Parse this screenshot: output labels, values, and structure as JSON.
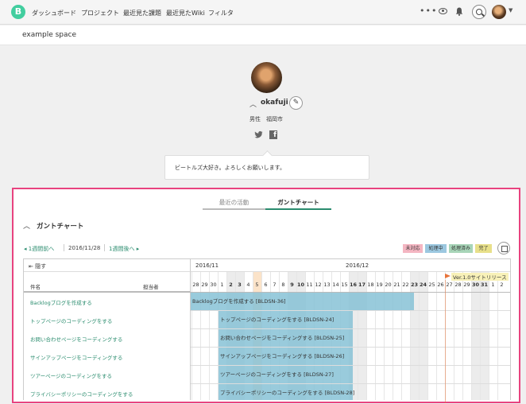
{
  "nav": {
    "logo": "B",
    "items": [
      "ダッシュボード",
      "プロジェクト",
      "最近見た課題",
      "最近見たWiki",
      "フィルタ"
    ],
    "more": "•••"
  },
  "space": {
    "name": "example space"
  },
  "profile": {
    "username": "okafuji",
    "gender": "男性",
    "city": "福岡市",
    "bio": "ビートルズ大好き。よろしくお願いします。"
  },
  "tabs": [
    {
      "label": "最近の活動",
      "active": false
    },
    {
      "label": "ガントチャート",
      "active": true
    }
  ],
  "gantt": {
    "heading": "ガントチャート",
    "prev_week": "1週間前へ",
    "current_date": "2016/11/28",
    "next_week": "1週間後へ",
    "hide": "隠す",
    "col_name": "件名",
    "col_assignee": "担当者",
    "legend": [
      {
        "label": "未対応",
        "color": "#f4b6c2"
      },
      {
        "label": "処理中",
        "color": "#9cc8e0"
      },
      {
        "label": "処理済み",
        "color": "#a8d5b8"
      },
      {
        "label": "完了",
        "color": "#e8e08a"
      }
    ],
    "months": [
      "2016/11",
      "2016/12"
    ],
    "days": [
      "28",
      "29",
      "30",
      "1",
      "2",
      "3",
      "4",
      "5",
      "6",
      "7",
      "8",
      "9",
      "10",
      "11",
      "12",
      "13",
      "14",
      "15",
      "16",
      "17",
      "18",
      "19",
      "20",
      "21",
      "22",
      "23",
      "24",
      "25",
      "26",
      "27",
      "28",
      "29",
      "30",
      "31",
      "1",
      "2"
    ],
    "milestone": "Ver.1.0サイトリリース",
    "tasks": [
      {
        "name": "Backlogブログを作成する",
        "bar": "Backlogブログを作成する [BLDSN-36]"
      },
      {
        "name": "トップページのコーディングをする",
        "bar": "トップページのコーディングをする [BLDSN-24]"
      },
      {
        "name": "お問い合わせページをコーディングする",
        "bar": "お問い合わせページをコーディングする [BLDSN-25]"
      },
      {
        "name": "サインアップページをコーディングする",
        "bar": "サインアップページをコーディングする [BLDSN-26]"
      },
      {
        "name": "ツアーページのコーディングをする",
        "bar": "ツアーページのコーディングをする [BLDSN-27]"
      },
      {
        "name": "プライバシーポリシーのコーディングをする",
        "bar": "プライバシーポリシーのコーディングをする [BLDSN-28]"
      }
    ]
  }
}
